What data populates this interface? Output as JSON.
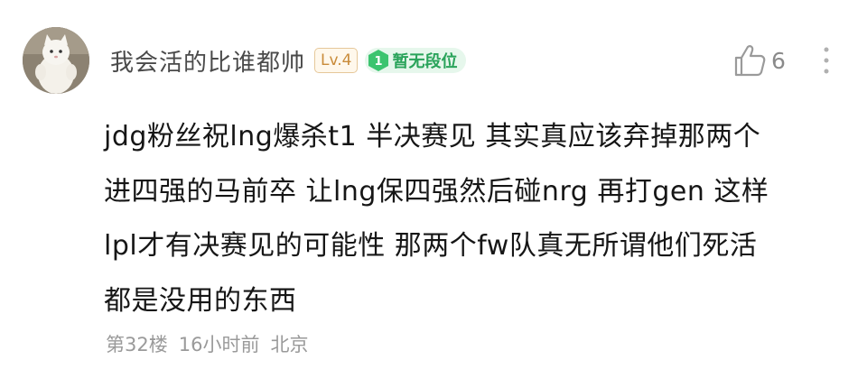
{
  "comment": {
    "avatar_icon": "white-cat-avatar-icon",
    "username": "我会活的比谁都帅",
    "level_badge": "Lv.4",
    "rank": {
      "number": "1",
      "label": "暂无段位",
      "color": "#29a35a"
    },
    "likes": {
      "icon": "thumbs-up-icon",
      "count": "6"
    },
    "more_icon": "more-vertical-icon",
    "content_lines": [
      "jdg粉丝祝lng爆杀t1 半决赛见 其实真应该弃掉那两个",
      "进四强的马前卒 让lng保四强然后碰nrg 再打gen 这样",
      "lpl才有决赛见的可能性 那两个fw队真无所谓他们死活",
      "都是没用的东西"
    ],
    "meta": {
      "floor": "第32楼",
      "time": "16小时前",
      "location": "北京"
    }
  }
}
